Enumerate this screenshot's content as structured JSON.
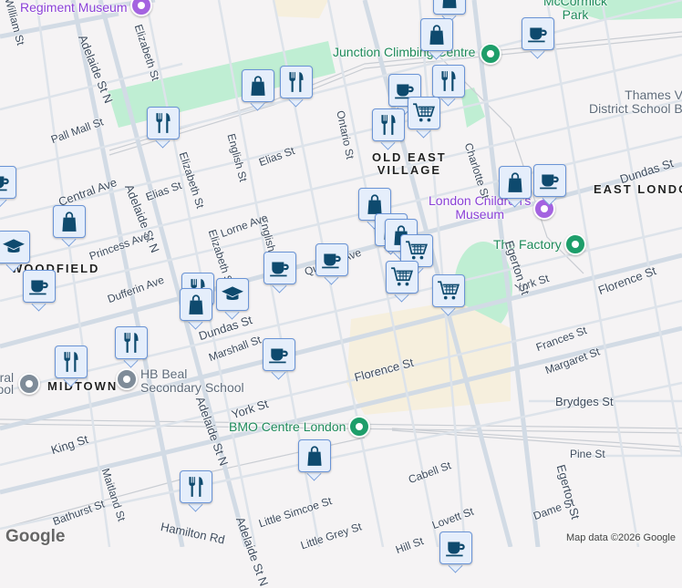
{
  "colors": {
    "background": "#f5f3f4",
    "park": "#bfeed3",
    "commercial": "#f6efdd",
    "road": "#d2dbe5",
    "marker_fill": "#e5eefb",
    "marker_border": "#6a94d6",
    "icon": "#0e4a6e"
  },
  "pois": {
    "regiment_museum": "Regiment Museum",
    "junction": "Junction Climbing Centre",
    "mccormick": "McCormick\nPark",
    "thames": "Thames Valley\nDistrict School Board",
    "childrens_museum": "London Children's\nMuseum",
    "factory": "The Factory",
    "bmo": "BMO Centre London",
    "hb_beal": "HB Beal\nSecondary School",
    "central_school": "Central\nSchool"
  },
  "areas": {
    "old_east": "OLD EAST\nVILLAGE",
    "east_london": "EAST LONDON",
    "woodfield": "WOODFIELD",
    "midtown": "MIDTOWN"
  },
  "streets": {
    "adelaide_n1": "Adelaide St N",
    "adelaide_n2": "Adelaide St N",
    "adelaide3": "Adelaide St N",
    "elizabeth1": "Elizabeth St",
    "elizabeth2": "Elizabeth St",
    "elizabeth3": "Elizabeth St",
    "pall_mall": "Pall Mall St",
    "central": "Central Ave",
    "elias1": "Elias St",
    "elias2": "Elias St",
    "english1": "English St",
    "english2": "English St",
    "lorne": "Lorne Ave",
    "princess": "Princess Ave",
    "ontario": "Ontario St",
    "charlotte": "Charlotte St",
    "dundas1": "Dundas St",
    "dundas2": "Dundas St",
    "queens": "Queens Ave",
    "dufferin": "Dufferin Ave",
    "marshall": "Marshall St",
    "york1": "York St",
    "york2": "York St",
    "king": "King St",
    "florence1": "Florence St",
    "florence2": "Florence St",
    "frances": "Frances St",
    "margaret": "Margaret St",
    "brydges": "Brydges St",
    "egerton1": "Egerton St",
    "egerton2": "Egerton St",
    "pine": "Pine St",
    "cabell": "Cabell St",
    "lovett": "Lovett St",
    "dame": "Dame St",
    "little_simcoe": "Little Simcoe St",
    "little_grey": "Little Grey St",
    "hamilton": "Hamilton Rd",
    "bathurst": "Bathurst St",
    "maitland": "Maitland St",
    "hill": "Hill St",
    "william": "William St"
  },
  "markers": [
    {
      "type": "shop"
    },
    {
      "type": "shop"
    },
    {
      "type": "cafe"
    },
    {
      "type": "shop"
    },
    {
      "type": "food"
    },
    {
      "type": "cafe"
    },
    {
      "type": "food"
    },
    {
      "type": "cart"
    },
    {
      "type": "food"
    },
    {
      "type": "food"
    },
    {
      "type": "cafe"
    },
    {
      "type": "shop"
    },
    {
      "type": "school"
    },
    {
      "type": "shop"
    },
    {
      "type": "shop"
    },
    {
      "type": "cafe"
    },
    {
      "type": "shop"
    },
    {
      "type": "shop"
    },
    {
      "type": "cart"
    },
    {
      "type": "cafe"
    },
    {
      "type": "cafe"
    },
    {
      "type": "cafe"
    },
    {
      "type": "food"
    },
    {
      "type": "shop"
    },
    {
      "type": "school"
    },
    {
      "type": "cart"
    },
    {
      "type": "cart"
    },
    {
      "type": "food"
    },
    {
      "type": "food"
    },
    {
      "type": "cafe"
    },
    {
      "type": "shop"
    },
    {
      "type": "food"
    },
    {
      "type": "cafe"
    }
  ],
  "logo": "Google",
  "attribution": "Map data ©2026 Google"
}
